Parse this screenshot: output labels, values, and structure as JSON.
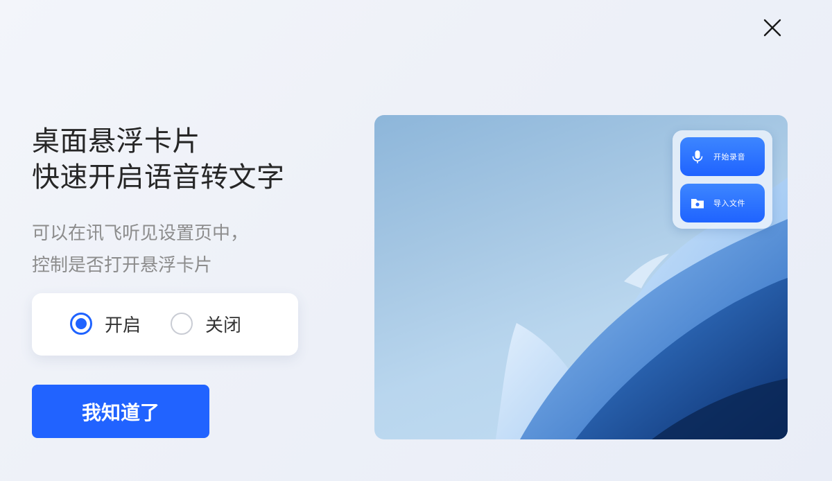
{
  "dialog": {
    "close_icon": "close-icon",
    "title_lines": [
      "桌面悬浮卡片",
      "快速开启语音转文字"
    ],
    "description_lines": [
      "可以在讯飞听见设置页中，",
      "控制是否打开悬浮卡片"
    ],
    "toggle": {
      "options": [
        {
          "label": "开启",
          "checked": true
        },
        {
          "label": "关闭",
          "checked": false
        }
      ]
    },
    "confirm_label": "我知道了",
    "preview": {
      "floating_card": {
        "record_label": "开始录音",
        "record_icon": "microphone-icon",
        "import_label": "导入文件",
        "import_icon": "folder-icon"
      }
    },
    "colors": {
      "accent": "#2163FF",
      "background": "#EEF1F8",
      "text_primary": "#262626",
      "text_secondary": "#8C8C8C"
    }
  }
}
